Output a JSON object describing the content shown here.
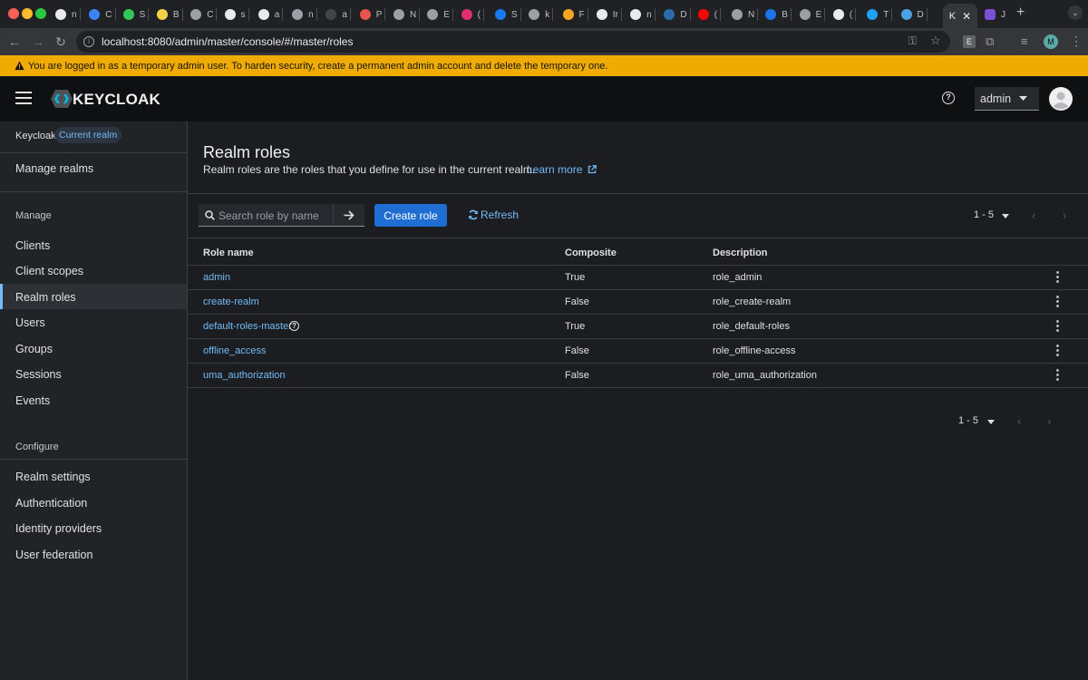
{
  "browser": {
    "tabs": [
      "n",
      "C",
      "S",
      "B",
      "C",
      "s",
      "a",
      "n",
      "a",
      "P",
      "N",
      "E",
      "(",
      "S",
      "k",
      "F",
      "Ir",
      "n",
      "D",
      "(",
      "N",
      "B",
      "E",
      "(",
      "T",
      "D"
    ],
    "active_tab_label": "K",
    "url": "localhost:8080/admin/master/console/#/master/roles",
    "profile_initial": "M",
    "ext_label": "E"
  },
  "banner": {
    "text": "You are logged in as a temporary admin user. To harden security, create a permanent admin account and delete the temporary one."
  },
  "masthead": {
    "brand": "KEYCLOAK",
    "user_menu": "admin"
  },
  "sidebar": {
    "realm_label": "Keycloak",
    "realm_badge": "Current realm",
    "manage_realms": "Manage realms",
    "manage_section": "Manage",
    "manage_items": [
      "Clients",
      "Client scopes",
      "Realm roles",
      "Users",
      "Groups",
      "Sessions",
      "Events"
    ],
    "configure_section": "Configure",
    "configure_items": [
      "Realm settings",
      "Authentication",
      "Identity providers",
      "User federation"
    ]
  },
  "page": {
    "title": "Realm roles",
    "description": "Realm roles are the roles that you define for use in the current realm.",
    "learn_more": "Learn more"
  },
  "toolbar": {
    "search_placeholder": "Search role by name",
    "create_label": "Create role",
    "refresh_label": "Refresh",
    "pagination": "1 - 5"
  },
  "table": {
    "headers": {
      "name": "Role name",
      "composite": "Composite",
      "description": "Description"
    },
    "rows": [
      {
        "name": "admin",
        "composite": "True",
        "description": "role_admin"
      },
      {
        "name": "create-realm",
        "composite": "False",
        "description": "role_create-realm"
      },
      {
        "name": "default-roles-master",
        "composite": "True",
        "description": "role_default-roles"
      },
      {
        "name": "offline_access",
        "composite": "False",
        "description": "role_offline-access"
      },
      {
        "name": "uma_authorization",
        "composite": "False",
        "description": "role_uma_authorization"
      }
    ]
  },
  "footer_pagination": "1 - 5",
  "colors": {
    "accent": "#73bcf7",
    "primary_button": "#1f6ed4",
    "banner": "#f0ab00",
    "active_indicator": "#73bcf7"
  }
}
